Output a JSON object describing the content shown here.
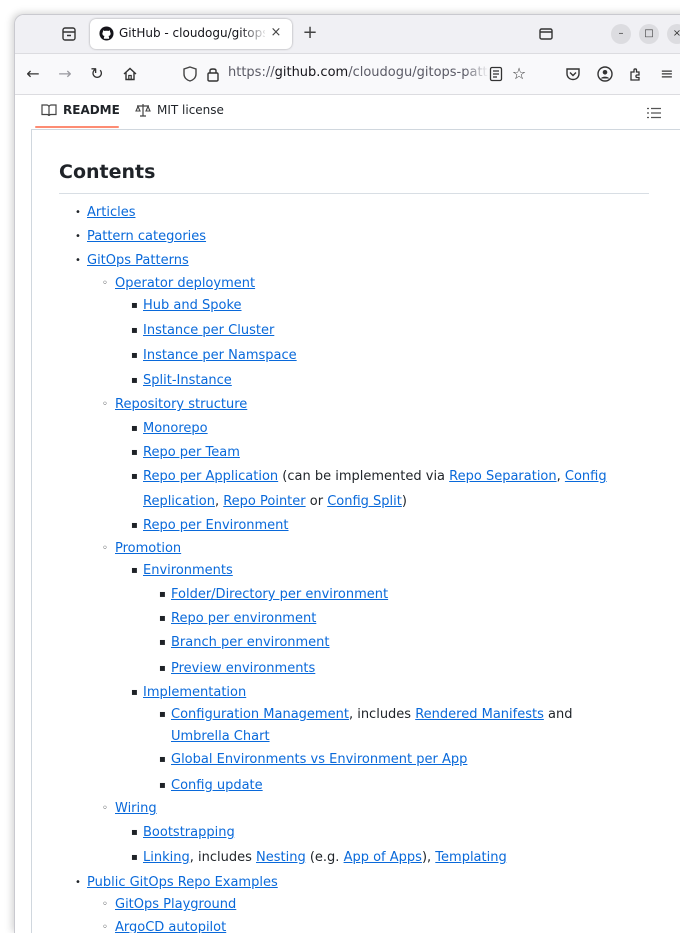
{
  "browser": {
    "tab_title": "GitHub - cloudogu/gitops-patterns",
    "tab_close_glyph": "×",
    "newtab_glyph": "+",
    "url_prefix": "https://",
    "url_host": "github.com",
    "url_path": "/cloudogu/gitops-patterns"
  },
  "readme_tabs": {
    "readme_label": "README",
    "license_label": "MIT license"
  },
  "contents": {
    "heading": "Contents",
    "items": [
      {
        "level": 1,
        "parts": [
          {
            "t": "Articles",
            "link": true
          }
        ]
      },
      {
        "level": 1,
        "parts": [
          {
            "t": "Pattern categories",
            "link": true
          }
        ]
      },
      {
        "level": 1,
        "parts": [
          {
            "t": "GitOps Patterns",
            "link": true
          }
        ]
      },
      {
        "level": 2,
        "parts": [
          {
            "t": "Operator deployment",
            "link": true
          }
        ]
      },
      {
        "level": 3,
        "parts": [
          {
            "t": "Hub and Spoke",
            "link": true
          }
        ]
      },
      {
        "level": 3,
        "parts": [
          {
            "t": "Instance per Cluster",
            "link": true
          }
        ]
      },
      {
        "level": 3,
        "parts": [
          {
            "t": "Instance per Namspace",
            "link": true
          }
        ]
      },
      {
        "level": 3,
        "parts": [
          {
            "t": "Split-Instance",
            "link": true
          }
        ]
      },
      {
        "level": 2,
        "parts": [
          {
            "t": "Repository structure",
            "link": true
          }
        ]
      },
      {
        "level": 3,
        "parts": [
          {
            "t": "Monorepo",
            "link": true
          }
        ]
      },
      {
        "level": 3,
        "parts": [
          {
            "t": "Repo per Team",
            "link": true
          }
        ]
      },
      {
        "level": 3,
        "parts": [
          {
            "t": "Repo per Application",
            "link": true
          },
          {
            "t": " (can be implemented via ",
            "link": false
          },
          {
            "t": "Repo Separation",
            "link": true
          },
          {
            "t": ", ",
            "link": false
          },
          {
            "t": "Config",
            "link": true
          }
        ]
      },
      {
        "level": 4,
        "parts": [
          {
            "t": "Replication",
            "link": true
          },
          {
            "t": ", ",
            "link": false
          },
          {
            "t": "Repo Pointer",
            "link": true
          },
          {
            "t": " or ",
            "link": false
          },
          {
            "t": "Config Split",
            "link": true
          },
          {
            "t": ")",
            "link": false
          }
        ]
      },
      {
        "level": 3,
        "parts": [
          {
            "t": "Repo per Environment",
            "link": true
          }
        ]
      },
      {
        "level": 2,
        "parts": [
          {
            "t": "Promotion",
            "link": true
          }
        ]
      },
      {
        "level": 3,
        "parts": [
          {
            "t": "Environments",
            "link": true
          }
        ]
      },
      {
        "level": 5,
        "parts": [
          {
            "t": "Folder/Directory per environment",
            "link": true
          }
        ]
      },
      {
        "level": 5,
        "parts": [
          {
            "t": "Repo per environment",
            "link": true
          }
        ]
      },
      {
        "level": 5,
        "parts": [
          {
            "t": "Branch per environment",
            "link": true
          }
        ]
      },
      {
        "level": 5,
        "parts": [
          {
            "t": "Preview environments",
            "link": true
          }
        ]
      },
      {
        "level": 3,
        "parts": [
          {
            "t": "Implementation",
            "link": true
          }
        ]
      },
      {
        "level": 5,
        "parts": [
          {
            "t": "Configuration Management",
            "link": true
          },
          {
            "t": ", includes ",
            "link": false
          },
          {
            "t": "Rendered Manifests",
            "link": true
          },
          {
            "t": " and",
            "link": false
          }
        ]
      },
      {
        "level": 6,
        "parts": [
          {
            "t": "Umbrella Chart",
            "link": true
          }
        ]
      },
      {
        "level": 5,
        "parts": [
          {
            "t": "Global Environments vs Environment per App",
            "link": true
          }
        ]
      },
      {
        "level": 5,
        "parts": [
          {
            "t": "Config update",
            "link": true
          }
        ]
      },
      {
        "level": 2,
        "parts": [
          {
            "t": "Wiring",
            "link": true
          }
        ]
      },
      {
        "level": 3,
        "parts": [
          {
            "t": "Bootstrapping",
            "link": true
          }
        ]
      },
      {
        "level": 3,
        "parts": [
          {
            "t": "Linking",
            "link": true
          },
          {
            "t": ", includes ",
            "link": false
          },
          {
            "t": "Nesting",
            "link": true
          },
          {
            "t": " (e.g. ",
            "link": false
          },
          {
            "t": "App of Apps",
            "link": true
          },
          {
            "t": "), ",
            "link": false
          },
          {
            "t": "Templating",
            "link": true
          }
        ]
      },
      {
        "level": 1,
        "parts": [
          {
            "t": "Public GitOps Repo Examples",
            "link": true
          }
        ]
      },
      {
        "level": 2,
        "parts": [
          {
            "t": "GitOps Playground",
            "link": true
          }
        ]
      },
      {
        "level": 2,
        "parts": [
          {
            "t": "ArgoCD autopilot",
            "link": true
          }
        ]
      }
    ]
  }
}
